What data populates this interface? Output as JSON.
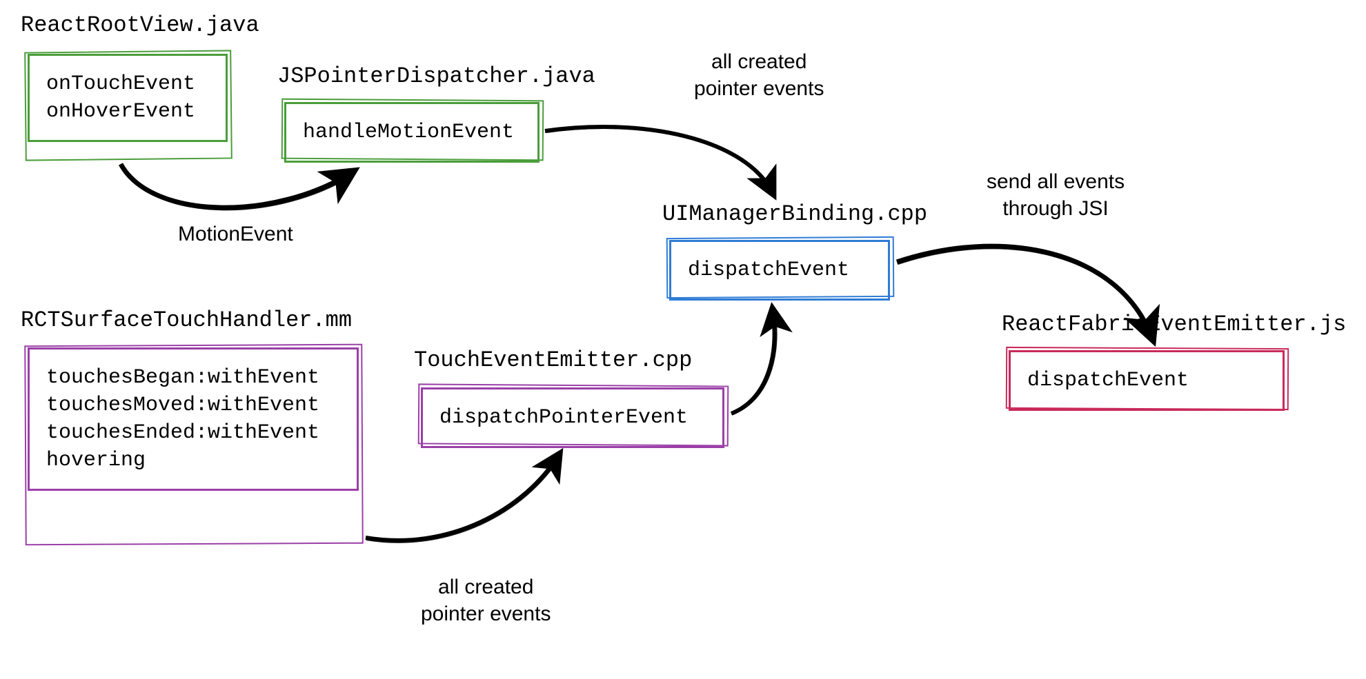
{
  "nodes": {
    "reactRootView": {
      "title": "ReactRootView.java",
      "items": [
        "onTouchEvent",
        "onHoverEvent"
      ],
      "color": "#4a9d3a"
    },
    "jsPointerDispatcher": {
      "title": "JSPointerDispatcher.java",
      "items": [
        "handleMotionEvent"
      ],
      "color": "#4a9d3a"
    },
    "rctSurfaceTouchHandler": {
      "title": "RCTSurfaceTouchHandler.mm",
      "items": [
        "touchesBegan:withEvent",
        "touchesMoved:withEvent",
        "touchesEnded:withEvent",
        "hovering"
      ],
      "color": "#9b3fa8"
    },
    "touchEventEmitter": {
      "title": "TouchEventEmitter.cpp",
      "items": [
        "dispatchPointerEvent"
      ],
      "color": "#9b3fa8"
    },
    "uiManagerBinding": {
      "title": "UIManagerBinding.cpp",
      "items": [
        "dispatchEvent"
      ],
      "color": "#2e7cd6"
    },
    "reactFabricEventEmitter": {
      "title": "ReactFabricEventEmitter.js",
      "items": [
        "dispatchEvent"
      ],
      "color": "#c92a5a"
    }
  },
  "labels": {
    "motionEvent": "MotionEvent",
    "allCreatedPointerEvents1": "all created\npointer events",
    "allCreatedPointerEvents2": "all created\npointer events",
    "sendAllEvents": "send all events\nthrough JSI"
  }
}
